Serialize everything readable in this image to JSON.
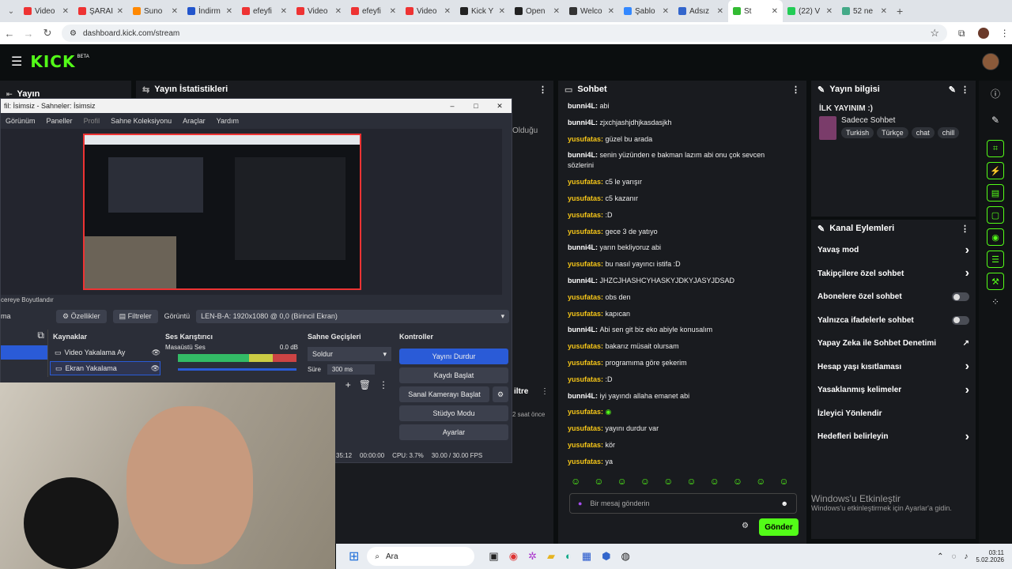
{
  "browser": {
    "tabs": [
      {
        "label": "Video",
        "color": "#e33"
      },
      {
        "label": "ŞARAI",
        "color": "#e33"
      },
      {
        "label": "Suno",
        "color": "#f80"
      },
      {
        "label": "İndirm",
        "color": "#25c"
      },
      {
        "label": "efeyfi",
        "color": "#e33"
      },
      {
        "label": "Video",
        "color": "#e33"
      },
      {
        "label": "efeyfi",
        "color": "#e33"
      },
      {
        "label": "Video",
        "color": "#e33"
      },
      {
        "label": "Kick Y",
        "color": "#222"
      },
      {
        "label": "Open",
        "color": "#222"
      },
      {
        "label": "Welco",
        "color": "#333"
      },
      {
        "label": "Şablo",
        "color": "#38f"
      },
      {
        "label": "Adsız",
        "color": "#36c"
      },
      {
        "label": "St",
        "color": "#3b3"
      },
      {
        "label": "(22) V",
        "color": "#2c5"
      },
      {
        "label": "52 ne",
        "color": "#4a8"
      }
    ],
    "url": "dashboard.kick.com/stream"
  },
  "header": {
    "logo": "KICK",
    "beta": "BETA"
  },
  "left": {
    "panel_title": "Yayın",
    "stats_title": "Yayın İstatistikleri",
    "olduğu": "Olduğu",
    "saat_once": "2 saat önce",
    "filtre": "iltre"
  },
  "obs": {
    "title": "fil: İsimsiz - Sahneler: İsimsiz",
    "menu": [
      "Görünüm",
      "Paneller",
      "Profil",
      "Sahne Koleksiyonu",
      "Araçlar",
      "Yardım"
    ],
    "resize_label": "cereye Boyutlandır",
    "ma": "ma",
    "props": "Özellikler",
    "filters": "Filtreler",
    "display_label": "Görüntü",
    "display_value": "LEN-B-A: 1920x1080 @ 0,0 (Birincil Ekran)",
    "sources_title": "Kaynaklar",
    "sources": [
      "Video Yakalama Ay",
      "Ekran Yakalama"
    ],
    "mixer_title": "Ses Karıştırıcı",
    "mixer_track": "Masaüstü Ses",
    "mixer_db": "0.0 dB",
    "transitions_title": "Sahne Geçişleri",
    "transition": "Soldur",
    "duration_label": "Süre",
    "duration": "300 ms",
    "controls_title": "Kontroller",
    "controls": [
      "Yayını Durdur",
      "Kaydı Başlat",
      "Sanal Kamerayı Başlat",
      "Stüdyo Modu",
      "Ayarlar"
    ],
    "status": {
      "time1": "35:12",
      "time2": "00:00:00",
      "cpu": "CPU: 3.7%",
      "fps": "30.00 / 30.00 FPS"
    }
  },
  "chat": {
    "title": "Sohbet",
    "messages": [
      {
        "user": "bunni4L",
        "text": "abi",
        "color": "#fff"
      },
      {
        "user": "bunni4L",
        "text": "zjxchjashjdhjkasdasjkh",
        "color": "#fff"
      },
      {
        "user": "yusufatas",
        "text": "güzel bu arada",
        "color": "#f5c518"
      },
      {
        "user": "bunni4L",
        "text": "senin yüzünden e bakman lazım abi onu çok sevcen sözlerini",
        "color": "#fff"
      },
      {
        "user": "yusufatas",
        "text": "c5 le yarışır",
        "color": "#f5c518"
      },
      {
        "user": "yusufatas",
        "text": "c5 kazanır",
        "color": "#f5c518"
      },
      {
        "user": "yusufatas",
        "text": ":D",
        "color": "#f5c518"
      },
      {
        "user": "yusufatas",
        "text": "gece 3 de yatıyo",
        "color": "#f5c518"
      },
      {
        "user": "bunni4L",
        "text": "yarın bekliyoruz abi",
        "color": "#fff"
      },
      {
        "user": "yusufatas",
        "text": "bu nasıl yayıncı istifa :D",
        "color": "#f5c518"
      },
      {
        "user": "bunni4L",
        "text": "JHZCJHASHCYHASKYJDKYJASYJDSAD",
        "color": "#fff"
      },
      {
        "user": "yusufatas",
        "text": "obs den",
        "color": "#f5c518"
      },
      {
        "user": "yusufatas",
        "text": "kapıcan",
        "color": "#f5c518"
      },
      {
        "user": "bunni4L",
        "text": "Abi sen git biz eko abiyle konusalım",
        "color": "#fff"
      },
      {
        "user": "yusufatas",
        "text": "bakarız müsait olursam",
        "color": "#f5c518"
      },
      {
        "user": "yusufatas",
        "text": "programıma göre şekerim",
        "color": "#f5c518"
      },
      {
        "user": "yusufatas",
        "text": ":D",
        "color": "#f5c518"
      },
      {
        "user": "bunni4L",
        "text": "iyi yayındı allaha emanet abi",
        "color": "#fff"
      },
      {
        "user": "yusufatas",
        "text": "",
        "color": "#f5c518"
      },
      {
        "user": "yusufatas",
        "text": "yayını durdur var",
        "color": "#f5c518"
      },
      {
        "user": "yusufatas",
        "text": "kör",
        "color": "#f5c518"
      },
      {
        "user": "yusufatas",
        "text": "ya",
        "color": "#f5c518"
      }
    ],
    "placeholder": "Bir mesaj gönderin",
    "send": "Gönder"
  },
  "info": {
    "title": "Yayın bilgisi",
    "stream_title": "İLK YAYINIM :)",
    "category": "Sadece Sohbet",
    "tags": [
      "Turkish",
      "Türkçe",
      "chat",
      "chill"
    ]
  },
  "actions": {
    "title": "Kanal Eylemleri",
    "items": [
      {
        "label": "Yavaş mod",
        "kind": "chevron"
      },
      {
        "label": "Takipçilere özel sohbet",
        "kind": "chevron"
      },
      {
        "label": "Abonelere özel sohbet",
        "kind": "toggle"
      },
      {
        "label": "Yalnızca ifadelerle sohbet",
        "kind": "toggle"
      },
      {
        "label": "Yapay Zeka ile Sohbet Denetimi",
        "kind": "ext"
      },
      {
        "label": "Hesap yaşı kısıtlaması",
        "kind": "chevron"
      },
      {
        "label": "Yasaklanmış kelimeler",
        "kind": "chevron"
      },
      {
        "label": "İzleyici Yönlendir",
        "kind": "none"
      },
      {
        "label": "Hedefleri belirleyin",
        "kind": "chevron"
      }
    ]
  },
  "windows": {
    "activate_title": "Windows'u Etkinleştir",
    "activate_sub": "Windows'u etkinleştirmek için Ayarlar'a gidin.",
    "search": "Ara",
    "time": "03:11",
    "date": "5.02.2026"
  },
  "colors": {
    "accent": "#53fc18",
    "panel": "#191b1f",
    "obs_blue": "#2a5bd7"
  }
}
